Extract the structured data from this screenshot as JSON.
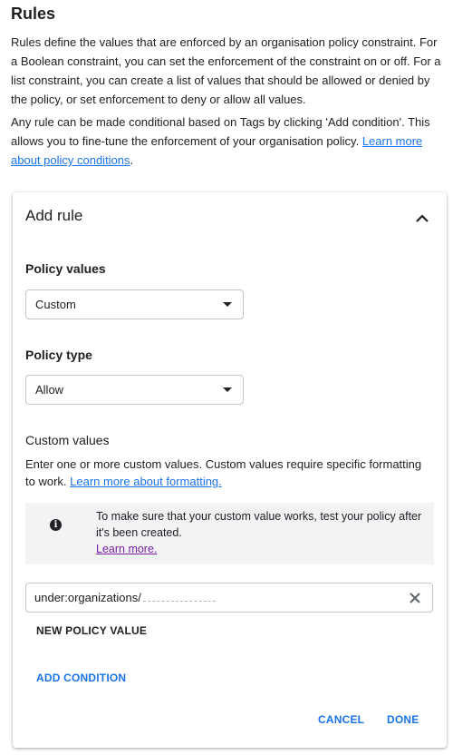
{
  "rules": {
    "title": "Rules",
    "description": "Rules define the values that are enforced by an organisation policy constraint. For a Boolean constraint, you can set the enforcement of the constraint on or off. For a list constraint, you can create a list of values that should be allowed or denied by the policy, or set enforcement to deny or allow all values.",
    "condition_text": "Any rule can be made conditional based on Tags by clicking 'Add condition'. This allows you to fine-tune the enforcement of your organisation policy. ",
    "condition_link": "Learn more about policy conditions",
    "condition_end": "."
  },
  "card": {
    "title": "Add rule",
    "policy_values_label": "Policy values",
    "policy_values_selected": "Custom",
    "policy_type_label": "Policy type",
    "policy_type_selected": "Allow",
    "custom_values_label": "Custom values",
    "custom_values_desc": "Enter one or more custom values. Custom values require specific formatting to work. ",
    "custom_values_link": "Learn more about formatting.",
    "info_text": "To make sure that your custom value works, test your policy after it's been created.",
    "info_link": "Learn more.",
    "value_input": "under:organizations/",
    "new_policy_value": "NEW POLICY VALUE",
    "add_condition": "ADD CONDITION",
    "cancel": "CANCEL",
    "done": "DONE"
  },
  "icons": {
    "collapse": "chevron-up-icon",
    "dropdown": "caret-down-icon",
    "info": "info-icon",
    "clear": "close-icon"
  },
  "colors": {
    "link": "#1a73e8",
    "visited_link": "#7b1fa2",
    "info_bg": "#f1f3f4"
  }
}
